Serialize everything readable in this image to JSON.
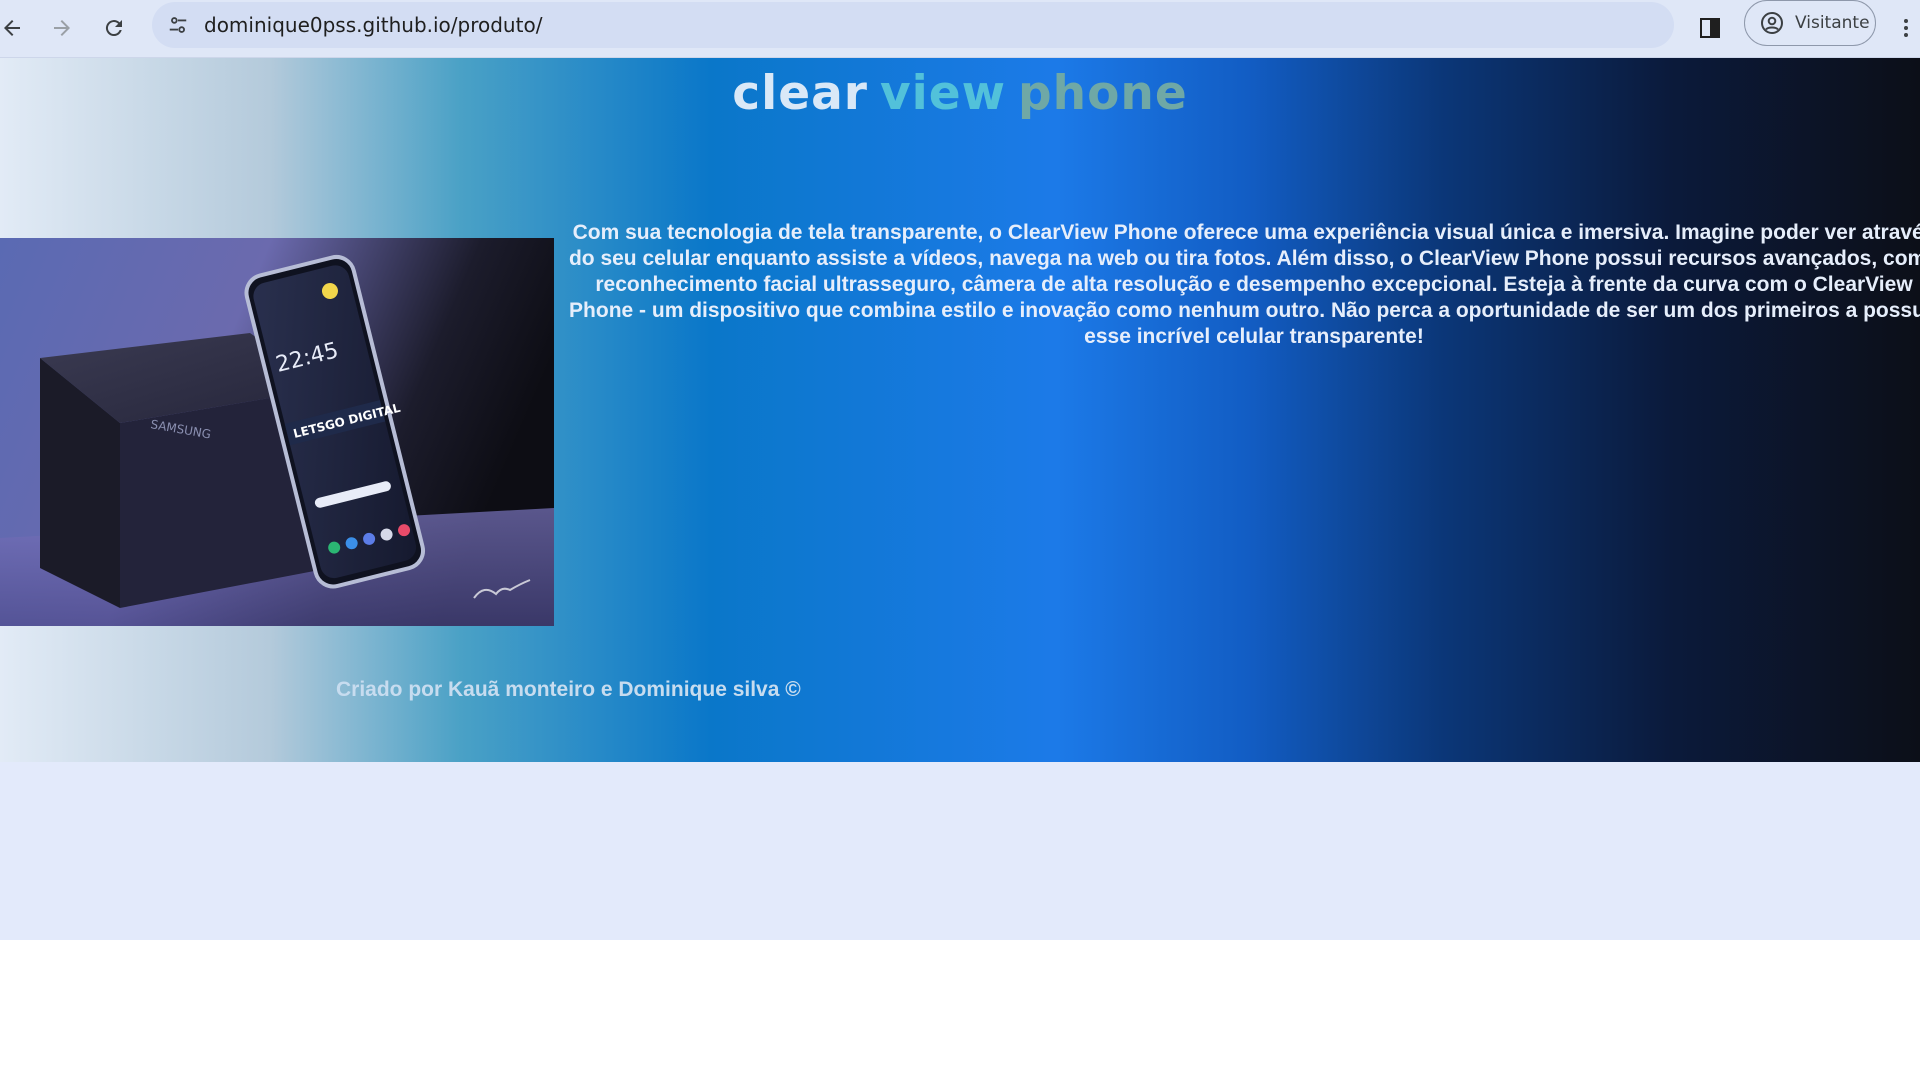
{
  "browser": {
    "url": "dominique0pss.github.io/produto/",
    "profile_label": "Visitante",
    "icons": {
      "back": "arrow-left-icon",
      "forward": "arrow-right-icon",
      "reload": "reload-icon",
      "site_info": "tune-icon",
      "side_panel": "side-panel-icon",
      "profile": "account-circle-icon",
      "menu": "kebab-menu-icon"
    }
  },
  "page": {
    "title_words": [
      "clear",
      "view",
      "phone"
    ],
    "title_colors": [
      "#d9e8f7",
      "#52c1da",
      "#6fa8a6"
    ],
    "description": "Com sua tecnologia de tela transparente, o ClearView Phone oferece uma experiência visual única e imersiva. Imagine poder ver através\ndo seu celular enquanto assiste a vídeos, navega na web ou tira fotos. Além disso, o ClearView Phone possui recursos avançados, como\nreconhecimento facial ultrasseguro, câmera de alta resolução e desempenho excepcional. Esteja à frente da curva com o ClearView\nPhone - um dispositivo que combina estilo e inovação como nenhum outro. Não perca a oportunidade de ser um dos primeiros a possuir\nesse incrível celular transparente!",
    "phone_screen": {
      "clock": "22:45",
      "banner": "LETSGO DIGITAL"
    },
    "footer": "Criado por Kauã monteiro e Dominique silva ©"
  },
  "colors": {
    "toolbar_bg": "#dfe7f7",
    "omnibox_bg": "#d3ddf3",
    "page_bg": "#e3eafb",
    "accent_blue": "#1c7ae8"
  }
}
